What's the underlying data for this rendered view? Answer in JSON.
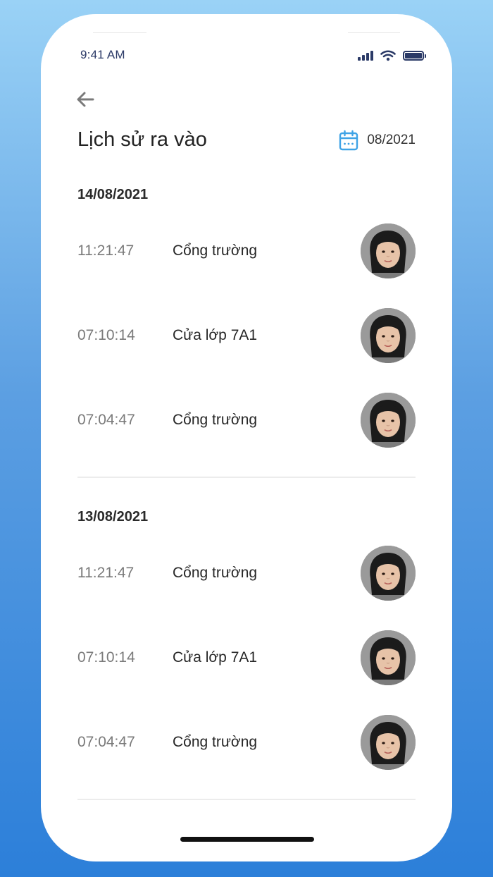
{
  "status_bar": {
    "time": "9:41 AM",
    "icons": [
      "cellular-signal-icon",
      "wifi-icon",
      "battery-icon"
    ]
  },
  "header": {
    "back_icon": "arrow-left-icon",
    "title": "Lịch sử ra vào",
    "calendar_icon": "calendar-icon",
    "month": "08/2021"
  },
  "colors": {
    "accent": "#3fa3e6",
    "background_top": "#9ad2f6",
    "background_bottom": "#2c7fd9",
    "time_text": "#7a7a7a",
    "title_text": "#222222"
  },
  "days": [
    {
      "date": "14/08/2021",
      "entries": [
        {
          "time": "11:21:47",
          "location": "Cổng trường"
        },
        {
          "time": "07:10:14",
          "location": "Cửa lớp 7A1"
        },
        {
          "time": "07:04:47",
          "location": "Cổng trường"
        }
      ]
    },
    {
      "date": "13/08/2021",
      "entries": [
        {
          "time": "11:21:47",
          "location": "Cổng trường"
        },
        {
          "time": "07:10:14",
          "location": "Cửa lớp 7A1"
        },
        {
          "time": "07:04:47",
          "location": "Cổng trường"
        }
      ]
    }
  ]
}
